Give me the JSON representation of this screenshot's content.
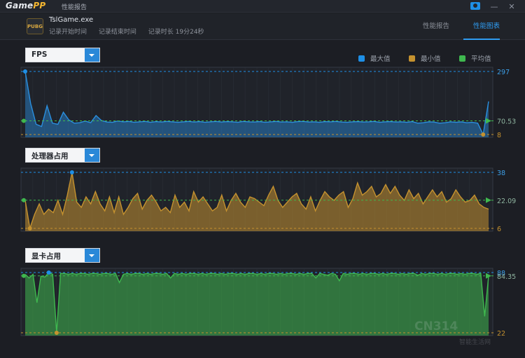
{
  "app": {
    "logo_main": "Game",
    "logo_accent": "PP",
    "window_title": "性能报告",
    "minimize": "—",
    "close": "✕"
  },
  "header": {
    "game_badge": "PUBG",
    "exe_name": "TslGame.exe",
    "record_start_label": "记录开始时间",
    "record_end_label": "记录结束时间",
    "duration_label": "记录时长 19分24秒",
    "tabs": [
      {
        "label": "性能报告",
        "active": false
      },
      {
        "label": "性能图表",
        "active": true
      }
    ]
  },
  "legend": {
    "max": "最大值",
    "min": "最小值",
    "avg": "平均值",
    "colors": {
      "max": "#1e8fe6",
      "min": "#c5922f",
      "avg": "#3fb84f"
    }
  },
  "charts": {
    "fps": {
      "select_label": "FPS",
      "color": "#2a8fdf",
      "max_label": "297",
      "avg_label": "70.53",
      "min_label": "8"
    },
    "cpu": {
      "select_label": "处理器占用",
      "color": "#c5922f",
      "max_label": "38",
      "avg_label": "22.09",
      "min_label": "6"
    },
    "gpu": {
      "select_label": "显卡占用",
      "color": "#3fb84f",
      "max_label": "88",
      "avg_label": "84.35",
      "min_label": "22"
    }
  },
  "chart_data": [
    {
      "type": "area",
      "title": "FPS",
      "ylim": [
        8,
        297
      ],
      "max": 297,
      "avg": 70.53,
      "min": 8,
      "values": [
        297,
        150,
        55,
        45,
        140,
        60,
        55,
        110,
        75,
        60,
        62,
        70,
        62,
        95,
        72,
        65,
        64,
        70,
        66,
        68,
        64,
        66,
        68,
        64,
        67,
        65,
        68,
        66,
        64,
        66,
        68,
        65,
        67,
        64,
        66,
        68,
        65,
        67,
        66,
        64,
        68,
        66,
        65,
        67,
        64,
        66,
        68,
        65,
        66,
        64,
        67,
        68,
        65,
        66,
        64,
        67,
        66,
        68,
        65,
        64,
        66,
        67,
        65,
        66,
        68,
        64,
        66,
        67,
        65,
        66,
        64,
        67,
        60,
        62,
        66,
        65,
        60,
        62,
        66,
        64,
        66,
        62,
        64,
        60,
        8,
        160
      ]
    },
    {
      "type": "area",
      "title": "处理器占用",
      "ylim": [
        6,
        38
      ],
      "max": 38,
      "avg": 22.09,
      "min": 6,
      "values": [
        22,
        6,
        14,
        20,
        14,
        17,
        15,
        22,
        14,
        25,
        38,
        21,
        18,
        24,
        20,
        27,
        20,
        16,
        24,
        15,
        24,
        14,
        18,
        23,
        26,
        17,
        22,
        25,
        21,
        16,
        18,
        15,
        25,
        18,
        21,
        16,
        27,
        21,
        24,
        20,
        16,
        18,
        25,
        16,
        22,
        26,
        21,
        18,
        24,
        23,
        21,
        19,
        25,
        30,
        22,
        18,
        21,
        24,
        26,
        20,
        17,
        24,
        16,
        22,
        27,
        24,
        22,
        25,
        27,
        18,
        23,
        32,
        25,
        27,
        30,
        24,
        26,
        31,
        26,
        30,
        25,
        22,
        28,
        23,
        26,
        20,
        24,
        28,
        24,
        27,
        21,
        23,
        28,
        24,
        21,
        22,
        25,
        20,
        18,
        17
      ]
    },
    {
      "type": "area",
      "title": "显卡占用",
      "ylim": [
        22,
        88
      ],
      "max": 88,
      "avg": 84.35,
      "min": 22,
      "values": [
        86,
        82,
        86,
        55,
        84,
        83,
        88,
        86,
        22,
        87,
        87,
        86,
        87,
        86,
        87,
        87,
        86,
        87,
        87,
        86,
        87,
        87,
        86,
        87,
        77,
        86,
        87,
        86,
        87,
        87,
        86,
        87,
        86,
        87,
        87,
        86,
        87,
        82,
        87,
        86,
        87,
        86,
        87,
        87,
        86,
        87,
        86,
        87,
        87,
        86,
        87,
        86,
        87,
        87,
        86,
        87,
        86,
        87,
        87,
        86,
        87,
        86,
        87,
        87,
        86,
        87,
        86,
        87,
        87,
        86,
        87,
        86,
        87,
        87,
        82,
        87,
        86,
        85,
        87,
        86,
        79,
        87,
        86,
        87,
        87,
        86,
        87,
        86,
        87,
        87,
        86,
        87,
        86,
        87,
        87,
        86,
        87,
        86,
        87,
        87,
        85,
        87,
        86,
        87,
        87,
        86,
        87,
        86,
        87,
        87,
        86,
        87,
        86,
        87,
        87,
        86,
        87,
        40,
        84
      ]
    }
  ],
  "watermark": {
    "text": "CN314",
    "sub": "智能生活网"
  }
}
